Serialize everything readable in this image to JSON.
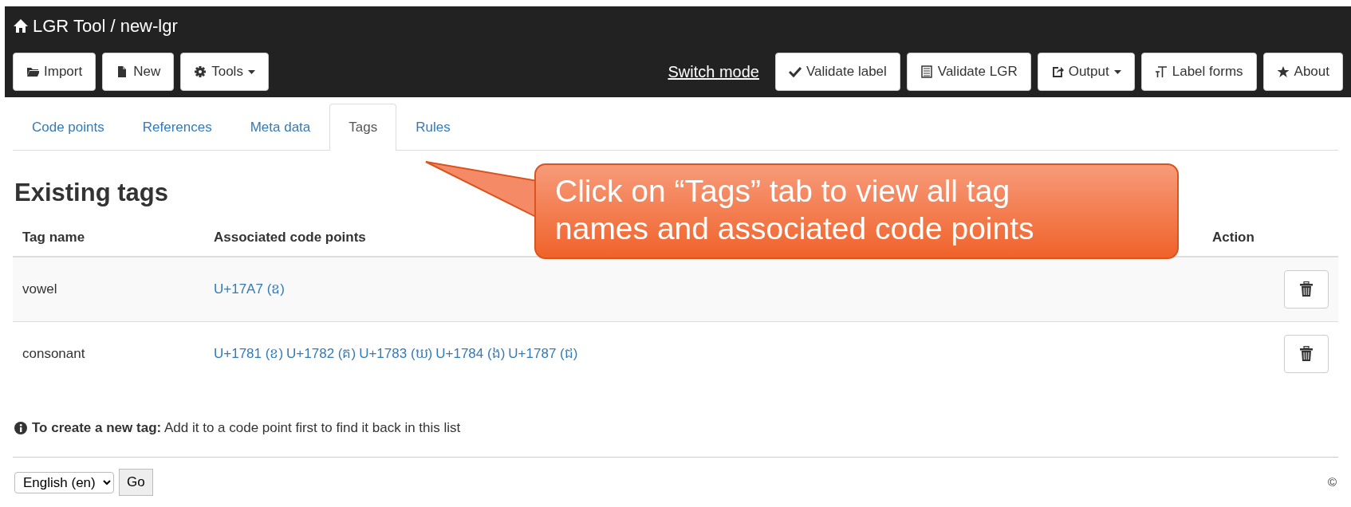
{
  "header": {
    "title": "LGR Tool / new-lgr",
    "left_buttons": [
      {
        "label": "Import",
        "dropdown": false
      },
      {
        "label": "New",
        "dropdown": false
      },
      {
        "label": "Tools",
        "dropdown": true
      }
    ],
    "switch_mode": "Switch mode",
    "right_buttons": [
      {
        "label": "Validate label",
        "dropdown": false
      },
      {
        "label": "Validate LGR",
        "dropdown": false
      },
      {
        "label": "Output",
        "dropdown": true
      },
      {
        "label": "Label forms",
        "dropdown": false
      },
      {
        "label": "About",
        "dropdown": false
      }
    ]
  },
  "tabs": [
    {
      "label": "Code points",
      "selected": false
    },
    {
      "label": "References",
      "selected": false
    },
    {
      "label": "Meta data",
      "selected": false
    },
    {
      "label": "Tags",
      "selected": true
    },
    {
      "label": "Rules",
      "selected": false
    }
  ],
  "heading": "Existing tags",
  "table": {
    "columns": [
      "Tag name",
      "Associated code points",
      "Action"
    ],
    "rows": [
      {
        "name": "vowel",
        "code_points": [
          "U+17A7 (ឧ)"
        ]
      },
      {
        "name": "consonant",
        "code_points": [
          "U+1781 (ខ)",
          "U+1782 (គ)",
          "U+1783 (ឃ)",
          "U+1784 (ង)",
          "U+1787 (ជ)"
        ]
      }
    ]
  },
  "note": "**To create a new tag:** Add it to a code point first to find it back in this list",
  "footer": {
    "language": "English (en)",
    "go": "Go",
    "copyright": "©"
  },
  "callout": "Click on “Tags” tab to view all tag names and associated code points"
}
